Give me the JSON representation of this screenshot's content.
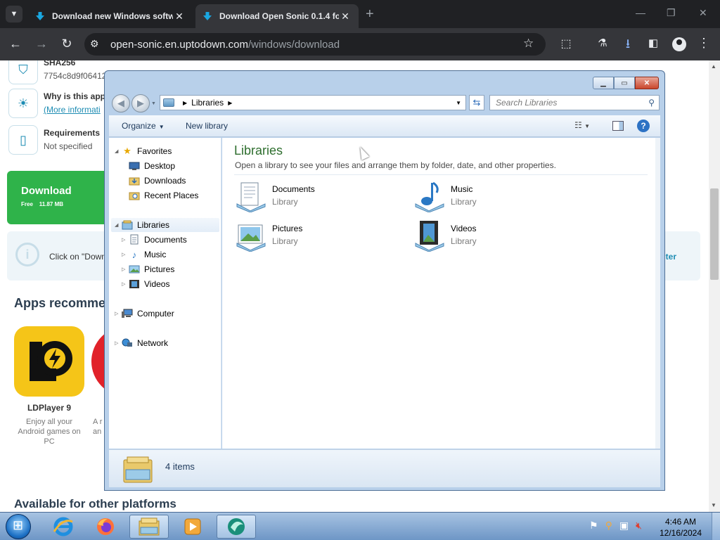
{
  "browser": {
    "tabs": [
      {
        "title": "Download new Windows softw",
        "close": "✕"
      },
      {
        "title": "Download Open Sonic 0.1.4 fo",
        "close": "✕"
      }
    ],
    "new_tab": "+",
    "window_controls": {
      "minimize": "—",
      "restore": "❐",
      "close": "✕"
    },
    "nav": {
      "back": "←",
      "forward": "→",
      "reload": "↻"
    },
    "url_host": "open-sonic.en.uptodown.com",
    "url_path": "/windows/download",
    "toolbar_icons": [
      "tune-icon",
      "star-icon",
      "extensions-icon",
      "labs-icon",
      "download-icon",
      "sidebar-icon",
      "profile-icon",
      "menu-icon"
    ],
    "accent_color": "#35363a"
  },
  "webpage": {
    "sha_title": "SHA256",
    "sha_value": "7754c8d9f06412",
    "why_title": "Why is this app",
    "why_link": "(More informati",
    "req_title": "Requirements",
    "req_value": "Not specified",
    "download_label": "Download",
    "download_free": "Free",
    "download_size": "11.87 MB",
    "notice_text": "Click on \"Down",
    "notice_more": "ter",
    "apps_heading": "Apps recommen",
    "app1_name": "LDPlayer 9",
    "app1_desc": "Enjoy all your Android games on PC",
    "app2_desc_1": "A r",
    "app2_desc_2": "an",
    "avail_heading": "Available for other platforms",
    "brand_green": "#2fb34a"
  },
  "explorer": {
    "address_segment": "Libraries",
    "search_placeholder": "Search Libraries",
    "organize": "Organize",
    "new_library": "New library",
    "help": "?",
    "nav": {
      "favorites": "Favorites",
      "desktop": "Desktop",
      "downloads": "Downloads",
      "recent": "Recent Places",
      "libraries": "Libraries",
      "documents": "Documents",
      "music": "Music",
      "pictures": "Pictures",
      "videos": "Videos",
      "computer": "Computer",
      "network": "Network"
    },
    "content_title": "Libraries",
    "content_subtitle": "Open a library to see your files and arrange them by folder, date, and other properties.",
    "libraries": [
      {
        "name": "Documents",
        "kind": "Library"
      },
      {
        "name": "Music",
        "kind": "Library"
      },
      {
        "name": "Pictures",
        "kind": "Library"
      },
      {
        "name": "Videos",
        "kind": "Library"
      }
    ],
    "item_count": "4 items"
  },
  "taskbar": {
    "time": "4:46 AM",
    "date": "12/16/2024",
    "pinned": [
      "internet-explorer-icon",
      "firefox-icon",
      "explorer-icon",
      "media-player-icon",
      "open-sonic-icon"
    ]
  }
}
